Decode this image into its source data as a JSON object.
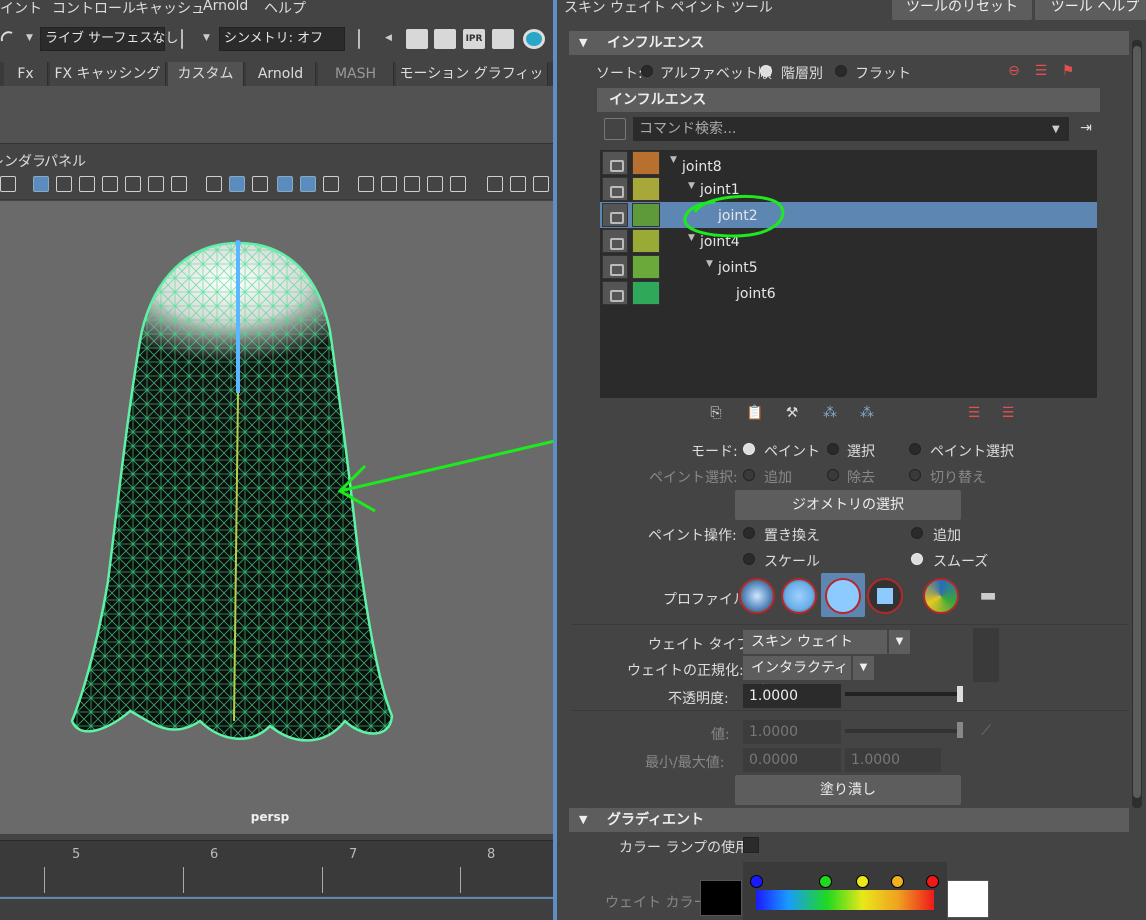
{
  "menubar": {
    "items": [
      "ペイント",
      "コントロール",
      "キャッシュ",
      "Arnold",
      "ヘルプ"
    ]
  },
  "statusline": {
    "live_surface": "ライブ サーフェスなし",
    "symmetry": "シンメトリ: オフ"
  },
  "shelf": {
    "tabs": [
      {
        "label": "Fx",
        "active": false
      },
      {
        "label": "FX キャッシング",
        "active": false
      },
      {
        "label": "カスタム",
        "active": true
      },
      {
        "label": "Arnold",
        "active": false
      },
      {
        "label": "MASH",
        "active": false
      },
      {
        "label": "モーション グラフィックス",
        "active": false
      }
    ]
  },
  "panel_menu": {
    "items": [
      "レンダラ",
      "パネル"
    ]
  },
  "viewport": {
    "camera_label": "persp"
  },
  "timeline": {
    "frames": [
      "5",
      "6",
      "7",
      "8"
    ]
  },
  "tool": {
    "title": "スキン ウェイト ペイント ツール",
    "reset_button": "ツールのリセット",
    "help_button": "ツール ヘルプ"
  },
  "influence": {
    "section_title": "インフルエンス",
    "sort_label": "ソート:",
    "sort_options": [
      "アルファベット順",
      "階層別",
      "フラット"
    ],
    "sort_selected": 1,
    "subsection_title": "インフルエンス",
    "search_placeholder": "コマンド検索...",
    "joints": [
      {
        "name": "joint8",
        "color": "#b8702e",
        "depth": 0,
        "has_children": true,
        "selected": false
      },
      {
        "name": "joint1",
        "color": "#a8a83a",
        "depth": 1,
        "has_children": true,
        "selected": false
      },
      {
        "name": "joint2",
        "color": "#5f9a3a",
        "depth": 2,
        "has_children": false,
        "selected": true
      },
      {
        "name": "joint4",
        "color": "#9aaa36",
        "depth": 1,
        "has_children": true,
        "selected": false
      },
      {
        "name": "joint5",
        "color": "#6aaa3a",
        "depth": 2,
        "has_children": true,
        "selected": false
      },
      {
        "name": "joint6",
        "color": "#30a85a",
        "depth": 3,
        "has_children": false,
        "selected": false
      }
    ]
  },
  "mode": {
    "label": "モード:",
    "options": [
      "ペイント",
      "選択",
      "ペイント選択"
    ],
    "selected": 0
  },
  "paint_select": {
    "label": "ペイント選択:",
    "options": [
      "追加",
      "除去",
      "切り替え"
    ]
  },
  "geometry_button": "ジオメトリの選択",
  "paint_operation": {
    "label": "ペイント操作:",
    "options": [
      "置き換え",
      "追加",
      "スケール",
      "スムーズ"
    ],
    "selected": 3
  },
  "profile": {
    "label": "プロファイル:"
  },
  "weight_type": {
    "label": "ウェイト タイプ:",
    "value": "スキン ウェイト"
  },
  "normalize": {
    "label": "ウェイトの正規化:",
    "value": "インタラクティブ"
  },
  "opacity": {
    "label": "不透明度:",
    "value": "1.0000",
    "level": 1.0
  },
  "value": {
    "label": "値:",
    "value": "1.0000",
    "level": 1.0
  },
  "minmax": {
    "label": "最小/最大値:",
    "min": "0.0000",
    "max": "1.0000"
  },
  "flood_button": "塗り潰し",
  "gradient": {
    "section_title": "グラディエント",
    "use_ramp_label": "カラー ランプの使用",
    "weight_color_label": "ウェイト カラー:",
    "marker_colors": [
      "#1a1aff",
      "#1fd91f",
      "#e8e81a",
      "#f0b020",
      "#ee1a1a"
    ]
  }
}
